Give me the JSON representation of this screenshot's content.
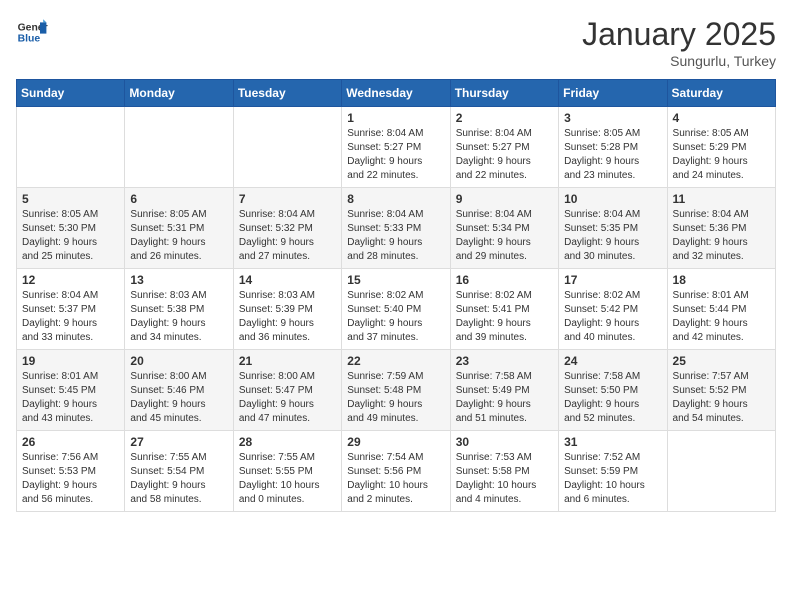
{
  "header": {
    "logo_general": "General",
    "logo_blue": "Blue",
    "month": "January 2025",
    "location": "Sungurlu, Turkey"
  },
  "calendar": {
    "days_of_week": [
      "Sunday",
      "Monday",
      "Tuesday",
      "Wednesday",
      "Thursday",
      "Friday",
      "Saturday"
    ],
    "weeks": [
      [
        {
          "day": "",
          "info": ""
        },
        {
          "day": "",
          "info": ""
        },
        {
          "day": "",
          "info": ""
        },
        {
          "day": "1",
          "info": "Sunrise: 8:04 AM\nSunset: 5:27 PM\nDaylight: 9 hours\nand 22 minutes."
        },
        {
          "day": "2",
          "info": "Sunrise: 8:04 AM\nSunset: 5:27 PM\nDaylight: 9 hours\nand 22 minutes."
        },
        {
          "day": "3",
          "info": "Sunrise: 8:05 AM\nSunset: 5:28 PM\nDaylight: 9 hours\nand 23 minutes."
        },
        {
          "day": "4",
          "info": "Sunrise: 8:05 AM\nSunset: 5:29 PM\nDaylight: 9 hours\nand 24 minutes."
        }
      ],
      [
        {
          "day": "5",
          "info": "Sunrise: 8:05 AM\nSunset: 5:30 PM\nDaylight: 9 hours\nand 25 minutes."
        },
        {
          "day": "6",
          "info": "Sunrise: 8:05 AM\nSunset: 5:31 PM\nDaylight: 9 hours\nand 26 minutes."
        },
        {
          "day": "7",
          "info": "Sunrise: 8:04 AM\nSunset: 5:32 PM\nDaylight: 9 hours\nand 27 minutes."
        },
        {
          "day": "8",
          "info": "Sunrise: 8:04 AM\nSunset: 5:33 PM\nDaylight: 9 hours\nand 28 minutes."
        },
        {
          "day": "9",
          "info": "Sunrise: 8:04 AM\nSunset: 5:34 PM\nDaylight: 9 hours\nand 29 minutes."
        },
        {
          "day": "10",
          "info": "Sunrise: 8:04 AM\nSunset: 5:35 PM\nDaylight: 9 hours\nand 30 minutes."
        },
        {
          "day": "11",
          "info": "Sunrise: 8:04 AM\nSunset: 5:36 PM\nDaylight: 9 hours\nand 32 minutes."
        }
      ],
      [
        {
          "day": "12",
          "info": "Sunrise: 8:04 AM\nSunset: 5:37 PM\nDaylight: 9 hours\nand 33 minutes."
        },
        {
          "day": "13",
          "info": "Sunrise: 8:03 AM\nSunset: 5:38 PM\nDaylight: 9 hours\nand 34 minutes."
        },
        {
          "day": "14",
          "info": "Sunrise: 8:03 AM\nSunset: 5:39 PM\nDaylight: 9 hours\nand 36 minutes."
        },
        {
          "day": "15",
          "info": "Sunrise: 8:02 AM\nSunset: 5:40 PM\nDaylight: 9 hours\nand 37 minutes."
        },
        {
          "day": "16",
          "info": "Sunrise: 8:02 AM\nSunset: 5:41 PM\nDaylight: 9 hours\nand 39 minutes."
        },
        {
          "day": "17",
          "info": "Sunrise: 8:02 AM\nSunset: 5:42 PM\nDaylight: 9 hours\nand 40 minutes."
        },
        {
          "day": "18",
          "info": "Sunrise: 8:01 AM\nSunset: 5:44 PM\nDaylight: 9 hours\nand 42 minutes."
        }
      ],
      [
        {
          "day": "19",
          "info": "Sunrise: 8:01 AM\nSunset: 5:45 PM\nDaylight: 9 hours\nand 43 minutes."
        },
        {
          "day": "20",
          "info": "Sunrise: 8:00 AM\nSunset: 5:46 PM\nDaylight: 9 hours\nand 45 minutes."
        },
        {
          "day": "21",
          "info": "Sunrise: 8:00 AM\nSunset: 5:47 PM\nDaylight: 9 hours\nand 47 minutes."
        },
        {
          "day": "22",
          "info": "Sunrise: 7:59 AM\nSunset: 5:48 PM\nDaylight: 9 hours\nand 49 minutes."
        },
        {
          "day": "23",
          "info": "Sunrise: 7:58 AM\nSunset: 5:49 PM\nDaylight: 9 hours\nand 51 minutes."
        },
        {
          "day": "24",
          "info": "Sunrise: 7:58 AM\nSunset: 5:50 PM\nDaylight: 9 hours\nand 52 minutes."
        },
        {
          "day": "25",
          "info": "Sunrise: 7:57 AM\nSunset: 5:52 PM\nDaylight: 9 hours\nand 54 minutes."
        }
      ],
      [
        {
          "day": "26",
          "info": "Sunrise: 7:56 AM\nSunset: 5:53 PM\nDaylight: 9 hours\nand 56 minutes."
        },
        {
          "day": "27",
          "info": "Sunrise: 7:55 AM\nSunset: 5:54 PM\nDaylight: 9 hours\nand 58 minutes."
        },
        {
          "day": "28",
          "info": "Sunrise: 7:55 AM\nSunset: 5:55 PM\nDaylight: 10 hours\nand 0 minutes."
        },
        {
          "day": "29",
          "info": "Sunrise: 7:54 AM\nSunset: 5:56 PM\nDaylight: 10 hours\nand 2 minutes."
        },
        {
          "day": "30",
          "info": "Sunrise: 7:53 AM\nSunset: 5:58 PM\nDaylight: 10 hours\nand 4 minutes."
        },
        {
          "day": "31",
          "info": "Sunrise: 7:52 AM\nSunset: 5:59 PM\nDaylight: 10 hours\nand 6 minutes."
        },
        {
          "day": "",
          "info": ""
        }
      ]
    ]
  }
}
